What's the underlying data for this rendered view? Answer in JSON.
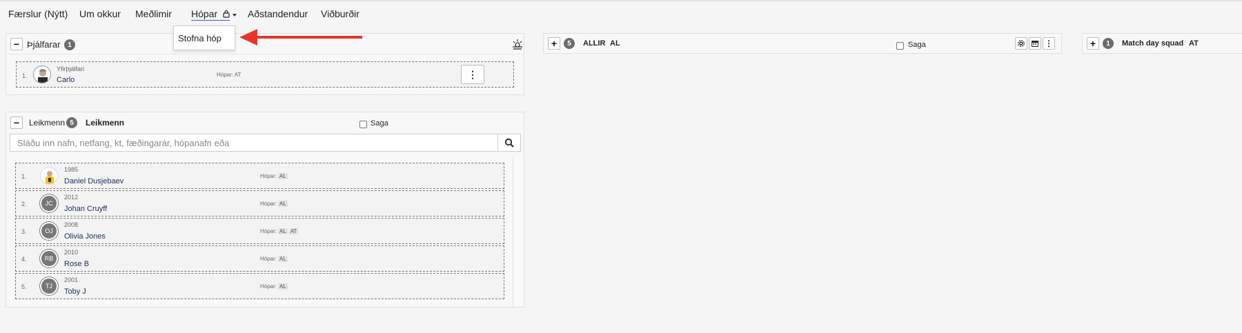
{
  "nav": {
    "items": [
      {
        "label": "Færslur (Nýtt)"
      },
      {
        "label": "Um okkur"
      },
      {
        "label": "Meðlimir"
      },
      {
        "label": "Hópar"
      },
      {
        "label": "Aðstandendur"
      },
      {
        "label": "Viðburðir"
      }
    ]
  },
  "dropdown": {
    "item": "Stofna hóp"
  },
  "coaches": {
    "title": "Þjálfarar",
    "count": "1",
    "rows": [
      {
        "num": "1.",
        "role": "Yfirþjálfari",
        "name": "Carlo",
        "groups_label": "Hópar:",
        "groups": "AT"
      }
    ]
  },
  "players": {
    "title": "Leikmenn",
    "count": "5",
    "subtitle": "Leikmenn",
    "history_label": "Saga",
    "search_placeholder": "Sláðu inn nafn, netfang, kt, fæðingarár, hópanafn eða",
    "rows": [
      {
        "num": "1.",
        "year": "1985",
        "name": "Daniel Dusjebaev",
        "initials": "",
        "groups_label": "Hópar:",
        "tags": [
          "AL"
        ]
      },
      {
        "num": "2.",
        "year": "2012",
        "name": "Johan Cruyff",
        "initials": "JC",
        "groups_label": "Hópar:",
        "tags": [
          "AL"
        ]
      },
      {
        "num": "3.",
        "year": "2008",
        "name": "Olivia Jones",
        "initials": "OJ",
        "groups_label": "Hópar:",
        "tags": [
          "AL",
          "AT"
        ]
      },
      {
        "num": "4.",
        "year": "2010",
        "name": "Rose B",
        "initials": "RB",
        "groups_label": "Hópar:",
        "tags": [
          "AL"
        ]
      },
      {
        "num": "5.",
        "year": "2001",
        "name": "Toby J",
        "initials": "TJ",
        "groups_label": "Hópar:",
        "tags": [
          "AL"
        ]
      }
    ]
  },
  "group_all": {
    "count": "5",
    "name": "ALLIR",
    "code": "AL",
    "history_label": "Saga"
  },
  "group_match": {
    "count": "1",
    "name": "Match day squad",
    "code": "AT"
  },
  "colors": {
    "accent": "#3b5ccc",
    "arrow": "#e8352a",
    "badge": "#6c6c6c"
  }
}
